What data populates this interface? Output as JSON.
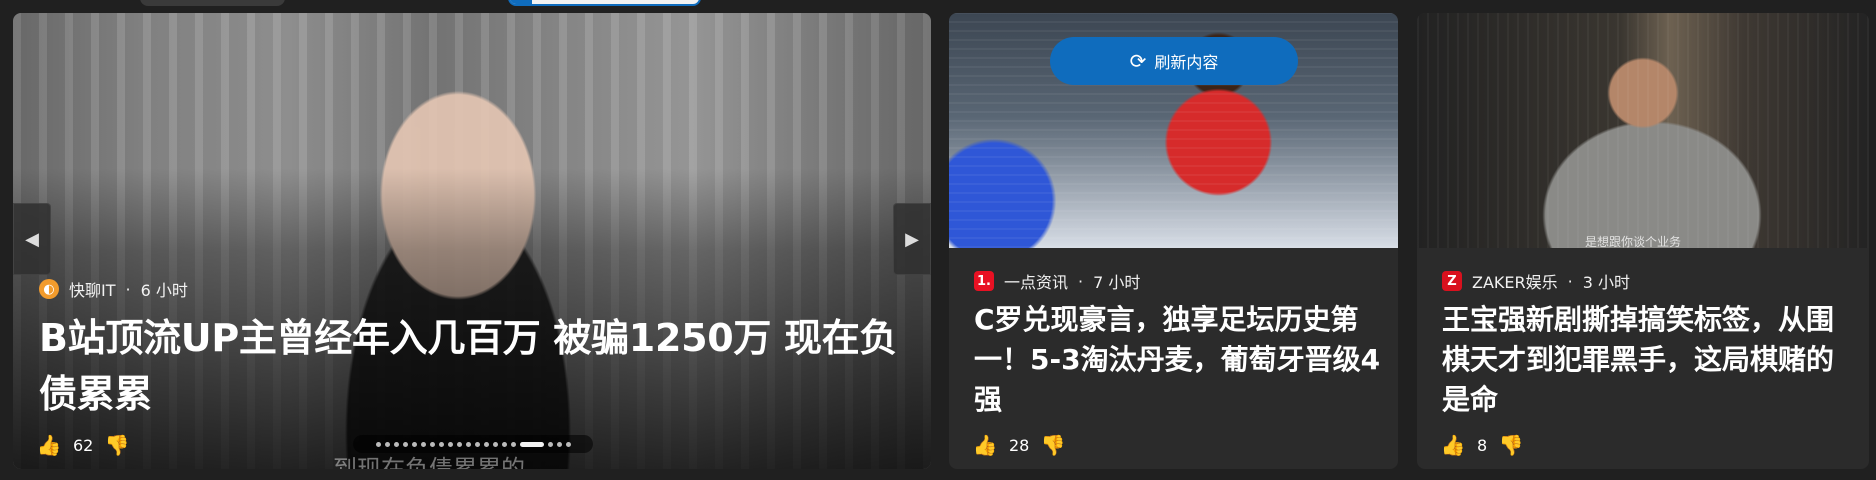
{
  "hero": {
    "source": "快聊IT",
    "time": "6 小时",
    "title": "B站顶流UP主曾经年入几百万 被骗1250万 现在负债累累",
    "likes": "62",
    "caption": "到现在负债累累的"
  },
  "cards": [
    {
      "source": "一点资讯",
      "time": "7 小时",
      "title": "C罗兑现豪言，独享足坛历史第一！5-3淘汰丹麦，葡萄牙晋级4强",
      "likes": "28",
      "refresh_label": "刷新内容"
    },
    {
      "source": "ZAKER娱乐",
      "time": "3 小时",
      "title": "王宝强新剧撕掉搞笑标签，从围棋天才到犯罪黑手，这局棋赌的是命",
      "likes": "8",
      "image_caption": "是想跟你谈个业务"
    }
  ],
  "icons": {
    "prev": "chevron-left-icon",
    "next": "chevron-right-icon",
    "like": "thumbs-up-icon",
    "dislike": "thumbs-down-icon",
    "refresh": "refresh-icon"
  },
  "colors": {
    "accent": "#0f6cbd",
    "source_yidian": "#e81123",
    "source_zaker": "#d9111e"
  }
}
